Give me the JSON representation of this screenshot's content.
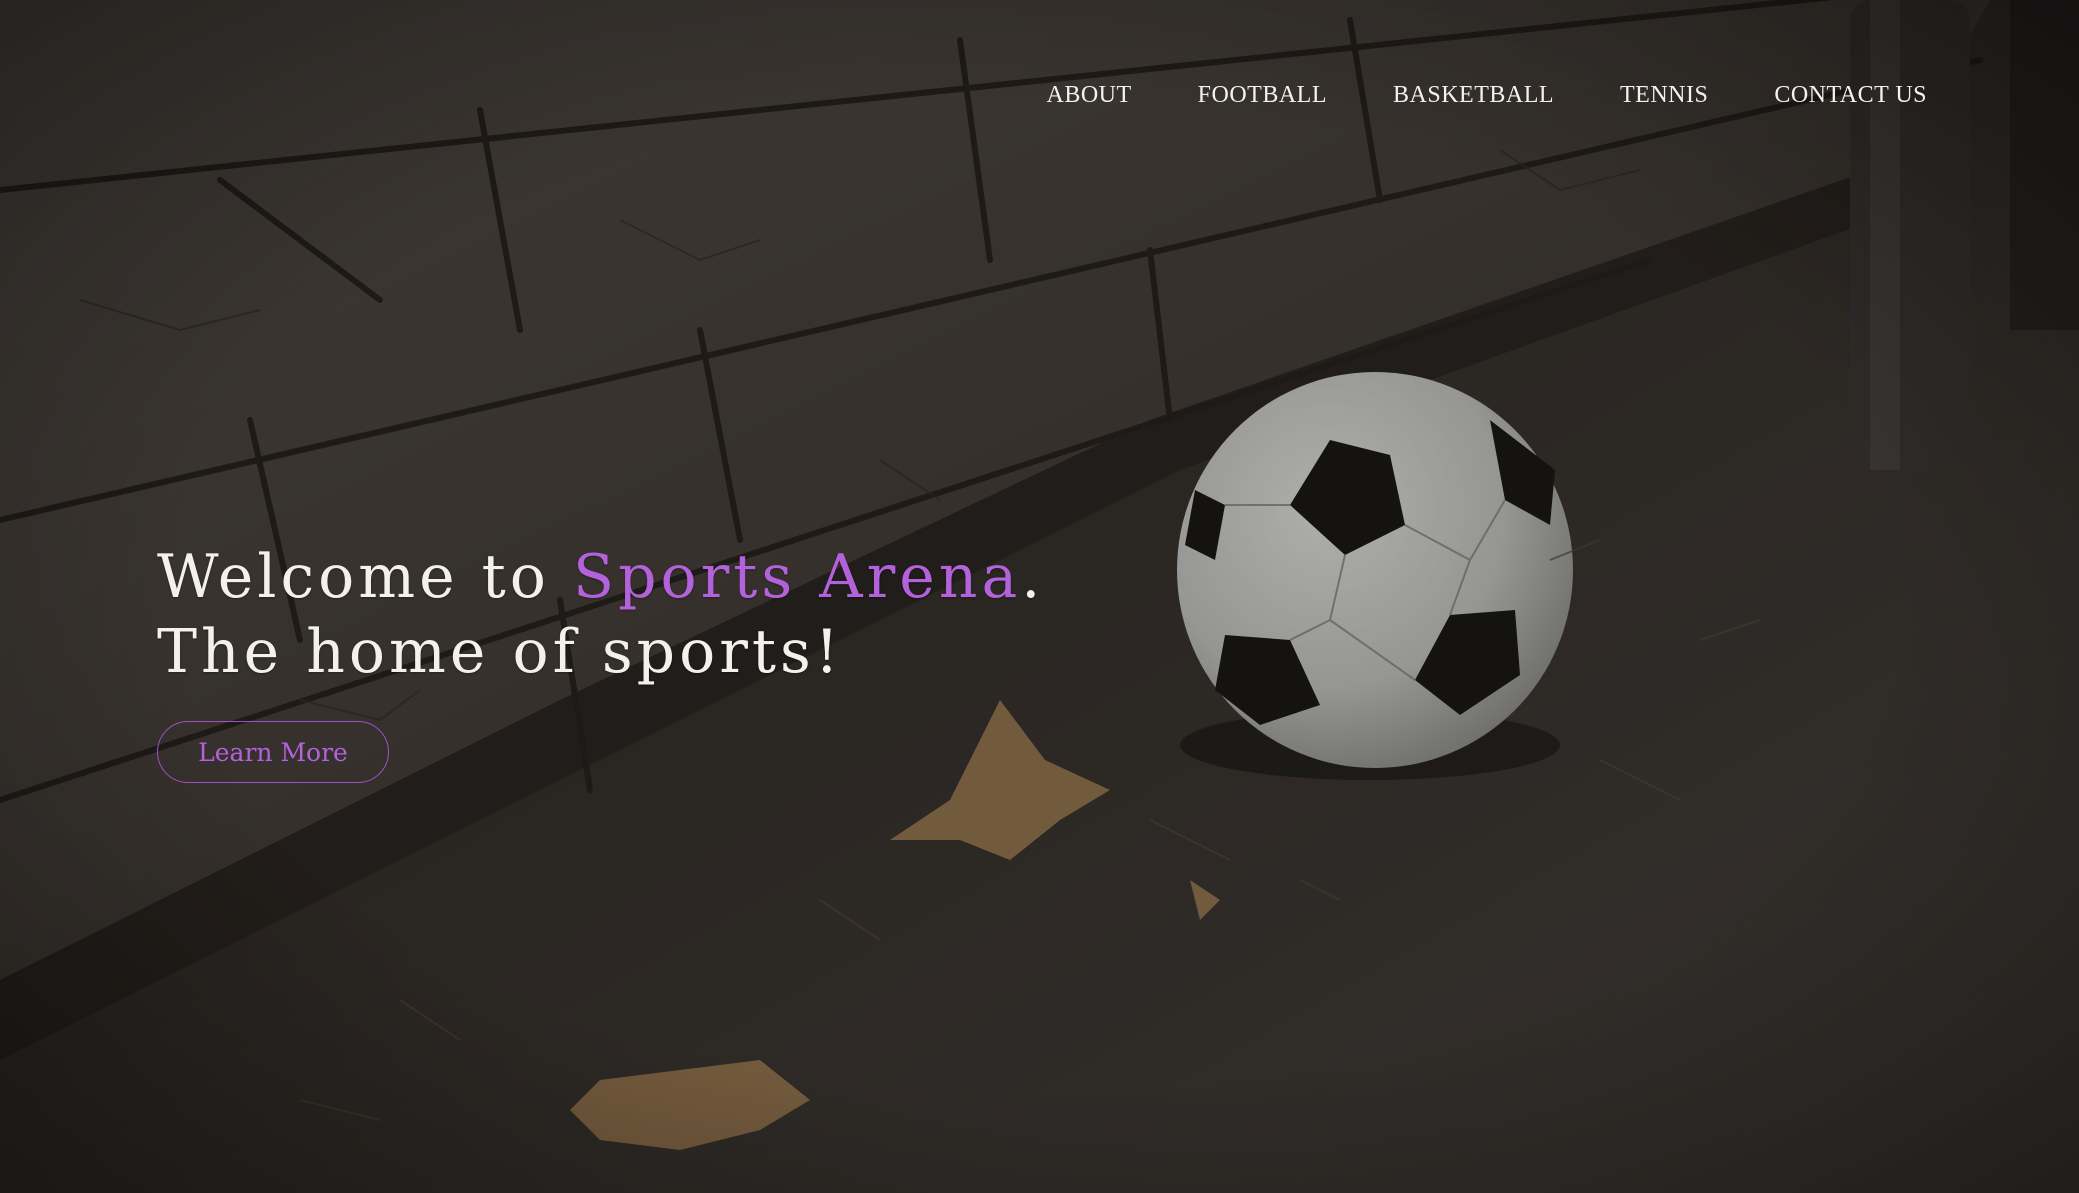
{
  "nav": {
    "items": [
      {
        "label": "ABOUT"
      },
      {
        "label": "FOOTBALL"
      },
      {
        "label": "BASKETBALL"
      },
      {
        "label": "TENNIS"
      },
      {
        "label": "CONTACT US"
      }
    ]
  },
  "hero": {
    "line1_prefix": "Welcome to ",
    "line1_brand": "Sports Arena",
    "line1_suffix": ".",
    "line2": "The home of sports!",
    "cta_label": "Learn More"
  },
  "colors": {
    "accent": "#b462dc",
    "text": "#f4f1ec",
    "overlay": "#000000"
  },
  "background": {
    "subject": "soccer-ball-by-stone-wall"
  }
}
